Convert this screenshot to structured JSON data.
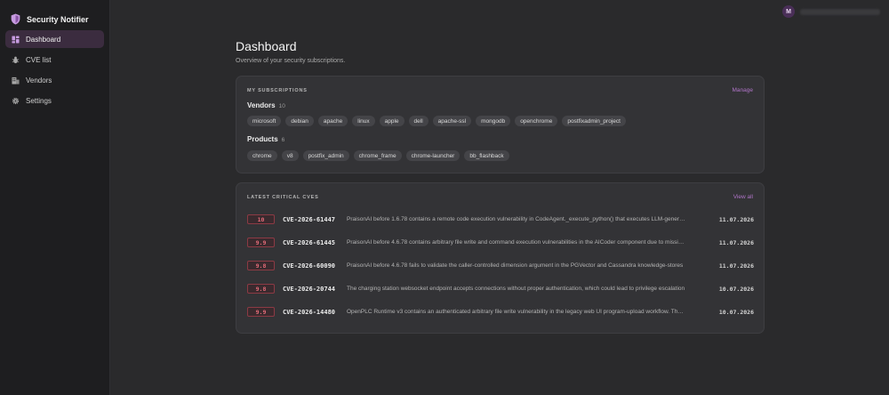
{
  "app": {
    "title": "Security Notifier"
  },
  "sidebar": {
    "items": [
      {
        "label": "Dashboard",
        "icon": "dashboard-icon",
        "active": true
      },
      {
        "label": "CVE list",
        "icon": "bug-icon",
        "active": false
      },
      {
        "label": "Vendors",
        "icon": "building-icon",
        "active": false
      },
      {
        "label": "Settings",
        "icon": "gear-icon",
        "active": false
      }
    ]
  },
  "user": {
    "initial": "M"
  },
  "page": {
    "title": "Dashboard",
    "subtitle": "Overview of your security subscriptions."
  },
  "subscriptions": {
    "label": "MY SUBSCRIPTIONS",
    "manage_label": "Manage",
    "vendors": {
      "title": "Vendors",
      "count": "10",
      "items": [
        "microsoft",
        "debian",
        "apache",
        "linux",
        "apple",
        "dell",
        "apache-ssl",
        "mongodb",
        "openchrome",
        "postfixadmin_project"
      ]
    },
    "products": {
      "title": "Products",
      "count": "6",
      "items": [
        "chrome",
        "v8",
        "postfix_admin",
        "chrome_frame",
        "chrome-launcher",
        "bb_flashback"
      ]
    }
  },
  "cves": {
    "label": "LATEST CRITICAL CVES",
    "view_all_label": "View all",
    "rows": [
      {
        "score": "10",
        "id": "CVE-2026-61447",
        "description": "PraisonAI before 1.6.78 contains a remote code execution vulnerability in CodeAgent._execute_python() that executes LLM-generated code",
        "date": "11.07.2026"
      },
      {
        "score": "9.9",
        "id": "CVE-2026-61445",
        "description": "PraisonAI before 4.6.78 contains arbitrary file write and command execution vulnerabilities in the AICoder component due to missing validation",
        "date": "11.07.2026"
      },
      {
        "score": "9.8",
        "id": "CVE-2026-60090",
        "description": "PraisonAI before 4.6.78 fails to validate the caller-controlled dimension argument in the PGVector and Cassandra knowledge-stores",
        "date": "11.07.2026"
      },
      {
        "score": "9.8",
        "id": "CVE-2026-20744",
        "description": "The charging station websocket endpoint accepts connections without proper authentication, which could lead to privilege escalation",
        "date": "10.07.2026"
      },
      {
        "score": "9.9",
        "id": "CVE-2026-14480",
        "description": "OpenPLC Runtime v3 contains an authenticated arbitrary file write vulnerability in the legacy web UI program-upload workflow. The issue",
        "date": "10.07.2026"
      }
    ]
  },
  "colors": {
    "accent": "#b074c8",
    "active_nav": "#3b2c3f",
    "critical": "#e36b78"
  }
}
